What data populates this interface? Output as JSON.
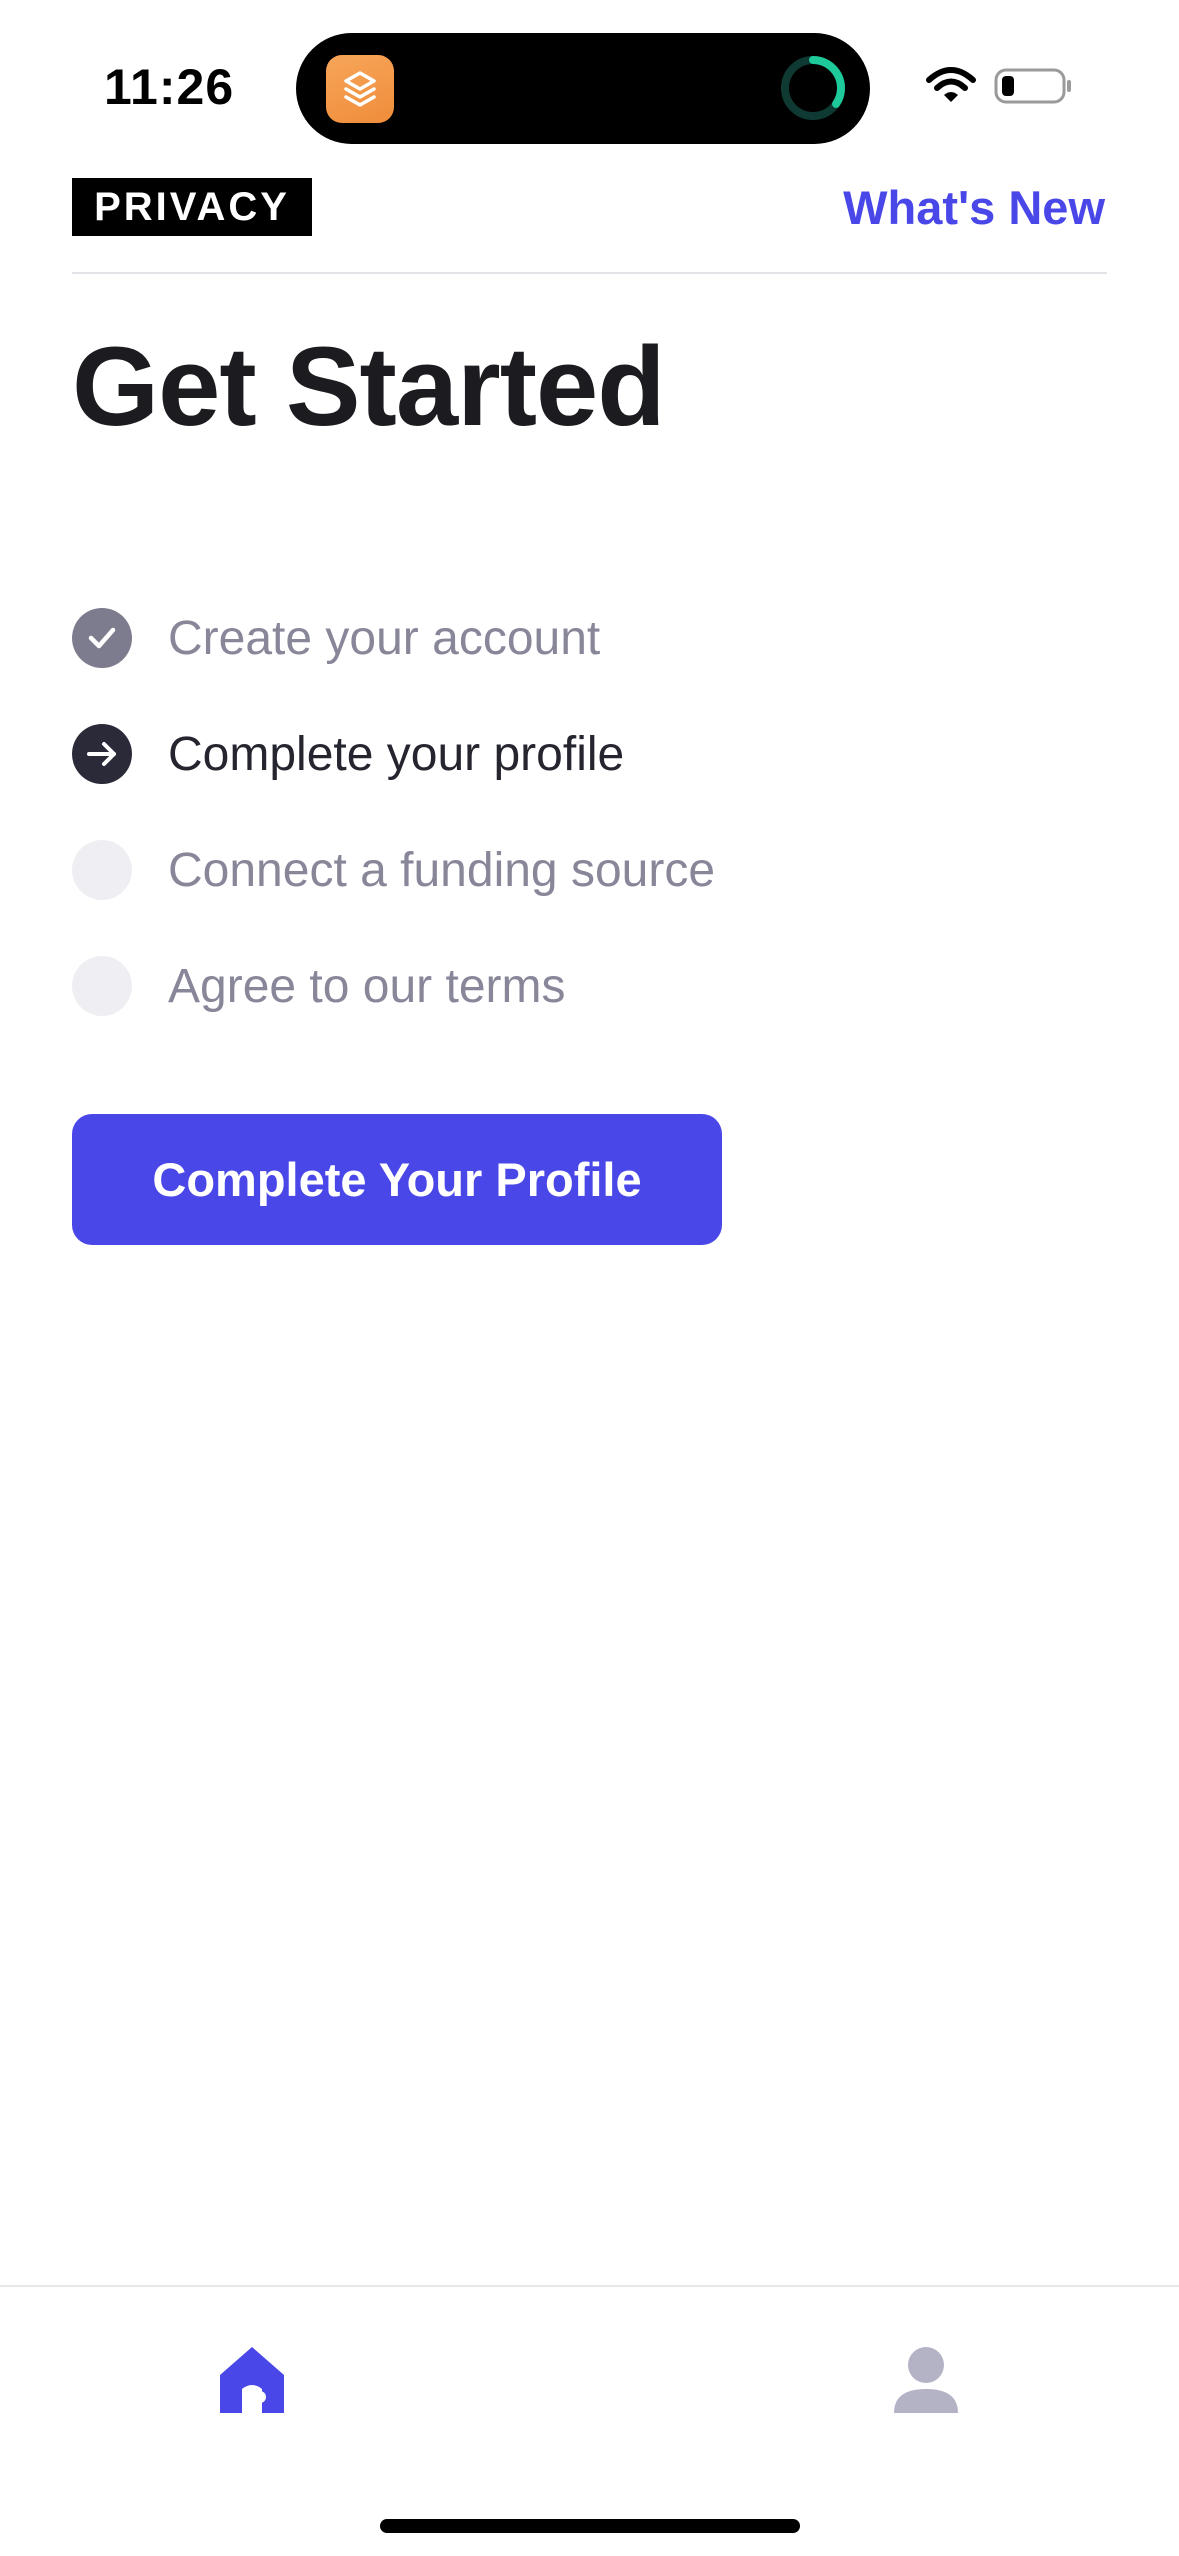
{
  "status_bar": {
    "time": "11:26"
  },
  "header": {
    "logo_text": "PRIVACY",
    "whats_new_label": "What's New"
  },
  "main": {
    "title": "Get Started",
    "steps": [
      {
        "label": "Create your account",
        "state": "done"
      },
      {
        "label": "Complete your profile",
        "state": "current"
      },
      {
        "label": "Connect a funding source",
        "state": "pending"
      },
      {
        "label": "Agree to our terms",
        "state": "pending"
      }
    ],
    "cta_label": "Complete Your Profile"
  },
  "tabbar": {
    "tabs": [
      {
        "icon": "home-icon",
        "active": true
      },
      {
        "icon": "profile-icon",
        "active": false
      }
    ]
  },
  "colors": {
    "accent": "#4a47e8",
    "step_done": "#7d7c8e",
    "step_current": "#2a2a38",
    "step_pending": "#efeff3",
    "muted_text": "#88879a",
    "tab_inactive": "#b4b3c6"
  }
}
